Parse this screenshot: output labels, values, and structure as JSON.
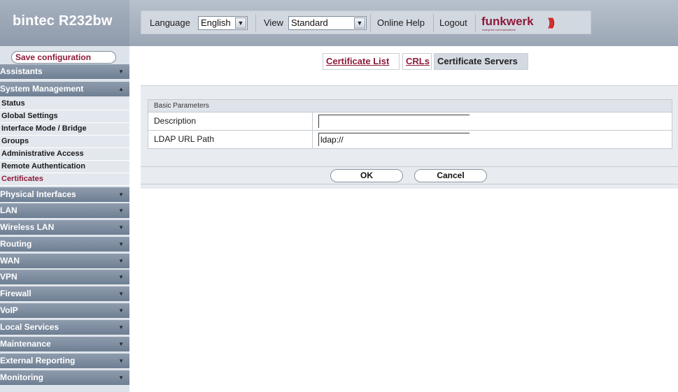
{
  "app": {
    "brand": "bintec R232bw",
    "logo": "funkwerk",
    "logo_subtitle": "enterprise communications"
  },
  "topbar": {
    "language_label": "Language",
    "language_value": "English",
    "view_label": "View",
    "view_value": "Standard",
    "online_help": "Online Help",
    "logout": "Logout"
  },
  "sidebar": {
    "save_configuration": "Save configuration",
    "items": [
      {
        "label": "Assistants",
        "expanded": false
      },
      {
        "label": "System Management",
        "expanded": true
      },
      {
        "label": "Physical Interfaces",
        "expanded": false
      },
      {
        "label": "LAN",
        "expanded": false
      },
      {
        "label": "Wireless LAN",
        "expanded": false
      },
      {
        "label": "Routing",
        "expanded": false
      },
      {
        "label": "WAN",
        "expanded": false
      },
      {
        "label": "VPN",
        "expanded": false
      },
      {
        "label": "Firewall",
        "expanded": false
      },
      {
        "label": "VoIP",
        "expanded": false
      },
      {
        "label": "Local Services",
        "expanded": false
      },
      {
        "label": "Maintenance",
        "expanded": false
      },
      {
        "label": "External Reporting",
        "expanded": false
      },
      {
        "label": "Monitoring",
        "expanded": false
      }
    ],
    "system_management_sub": [
      {
        "label": "Status"
      },
      {
        "label": "Global Settings"
      },
      {
        "label": "Interface Mode / Bridge Groups"
      },
      {
        "label": "Administrative Access"
      },
      {
        "label": "Remote Authentication"
      },
      {
        "label": "Certificates",
        "active": true
      }
    ],
    "sub_line1": "Interface Mode / Bridge",
    "sub_line2": "Groups"
  },
  "tabs": [
    {
      "label": "Certificate List",
      "current": false
    },
    {
      "label": "CRLs",
      "current": false
    },
    {
      "label": "Certificate Servers",
      "current": true
    }
  ],
  "form": {
    "section_title": "Basic Parameters",
    "fields": [
      {
        "label": "Description",
        "value": ""
      },
      {
        "label": "LDAP URL Path",
        "value": "ldap://"
      }
    ]
  },
  "buttons": {
    "ok": "OK",
    "cancel": "Cancel"
  },
  "colors": {
    "accent": "#8e1a3a",
    "nav_bg": "#7a899b",
    "panel_bg": "#e8ecf0"
  }
}
